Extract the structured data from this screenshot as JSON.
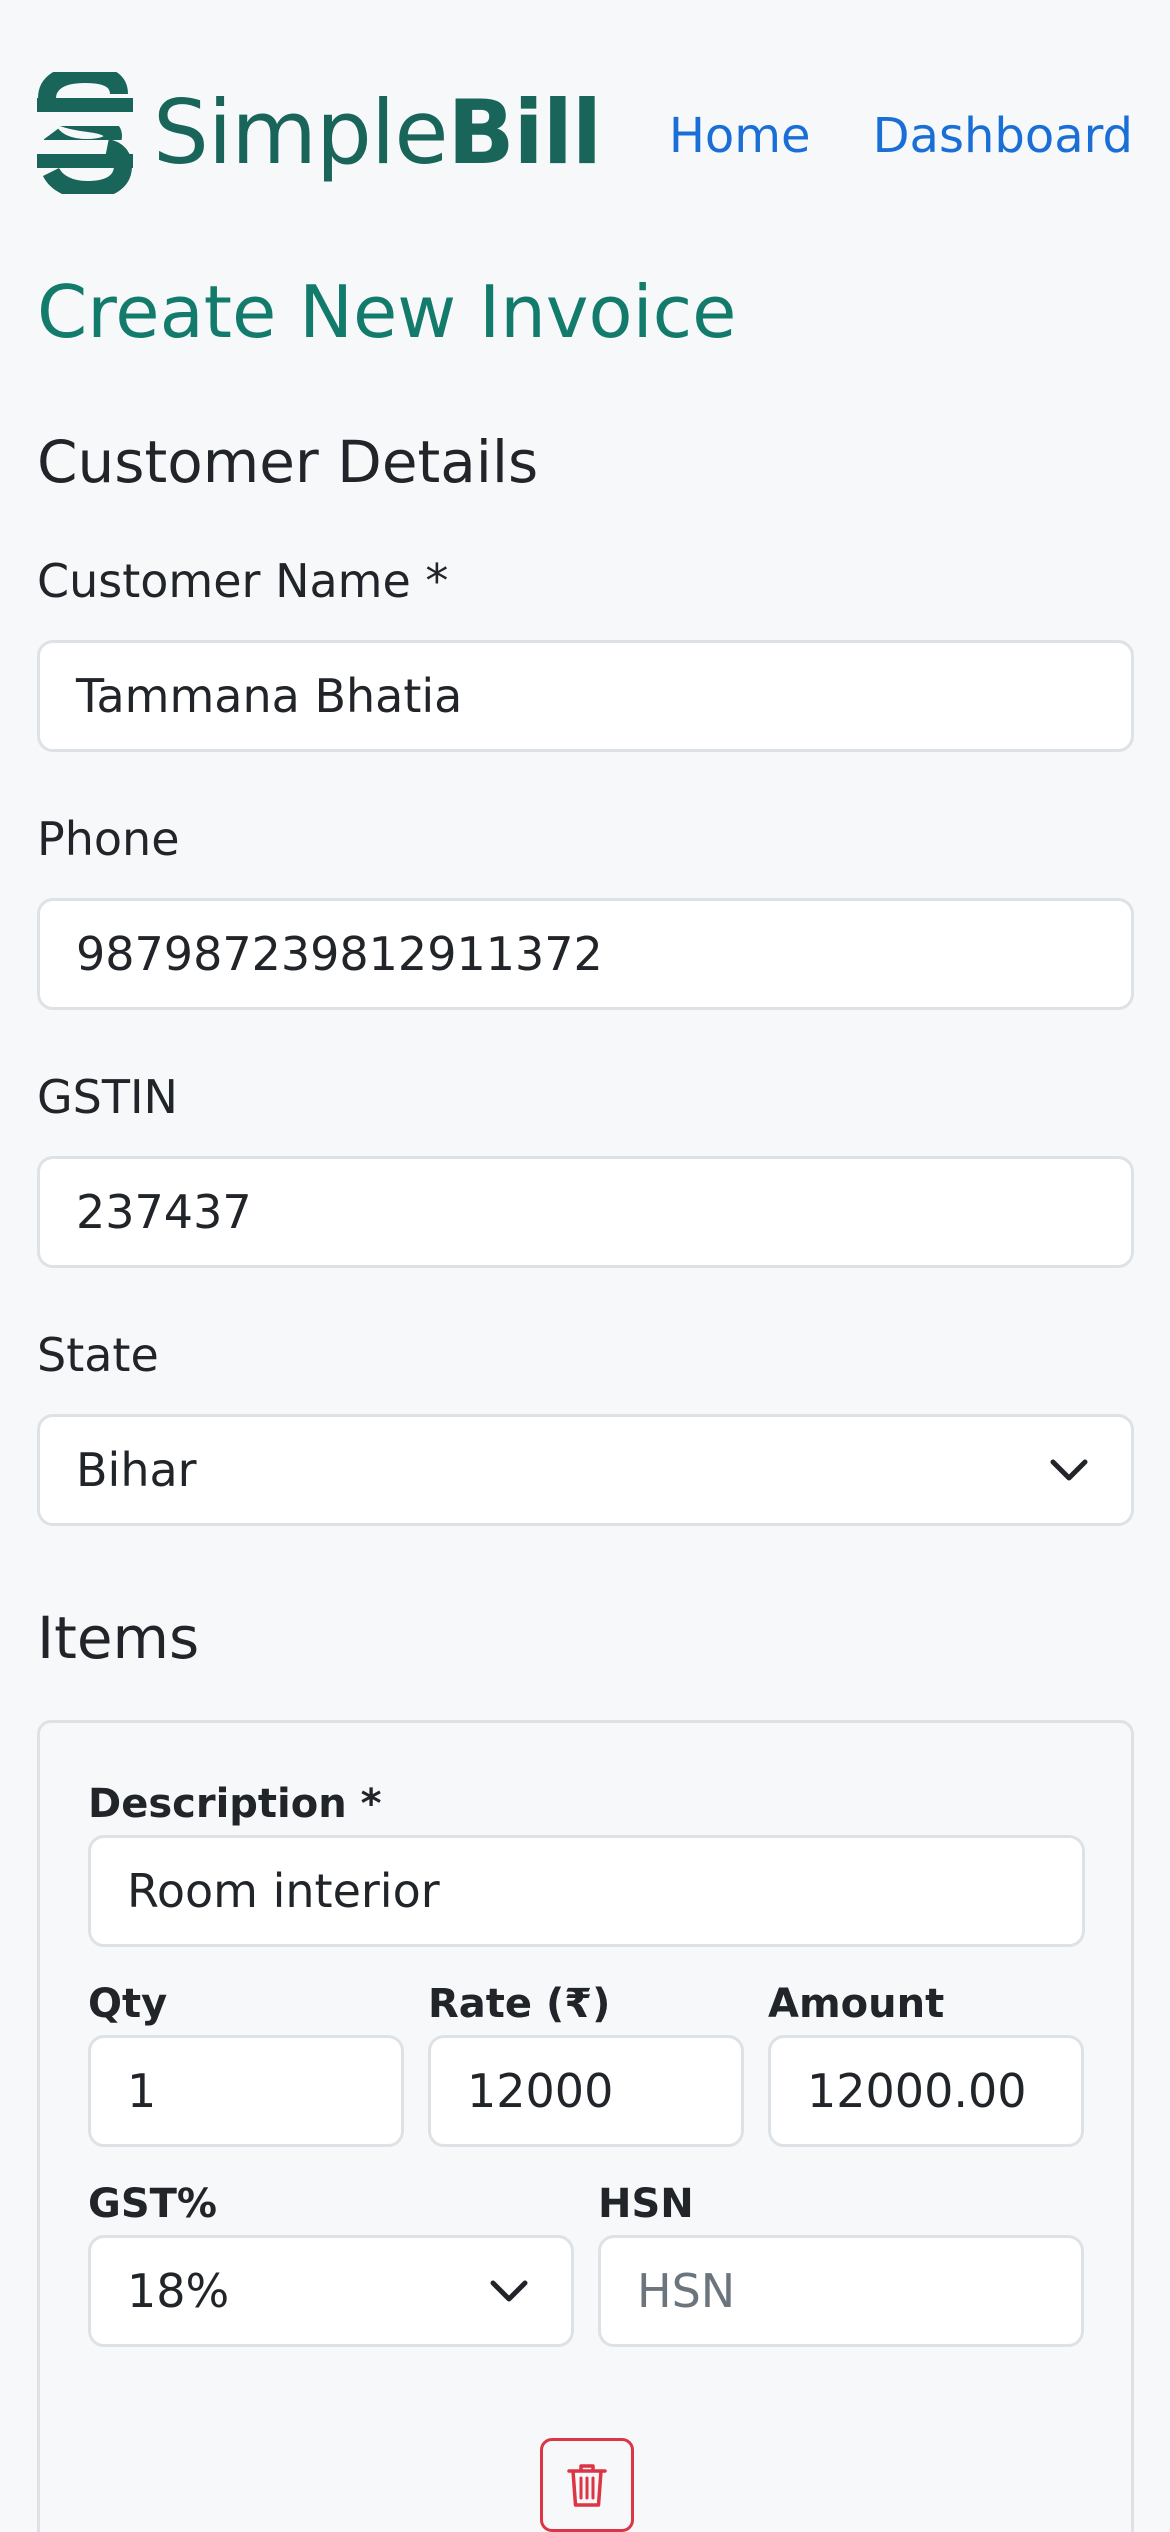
{
  "brand": {
    "name_light": "Simple",
    "name_bold": "Bill",
    "color": "#19655a"
  },
  "nav": {
    "items": [
      "Home",
      "Dashboard"
    ],
    "link_color": "#1a6fd6"
  },
  "page": {
    "title": "Create New Invoice",
    "title_color": "#137b6b"
  },
  "customer": {
    "section_title": "Customer Details",
    "name_label": "Customer Name *",
    "name_value": "Tammana Bhatia",
    "phone_label": "Phone",
    "phone_value": "987987239812911372",
    "gstin_label": "GSTIN",
    "gstin_value": "237437",
    "state_label": "State",
    "state_value": "Bihar"
  },
  "items": {
    "section_title": "Items",
    "rows": [
      {
        "description_label": "Description *",
        "description_value": "Room interior",
        "qty_label": "Qty",
        "qty_value": "1",
        "rate_label": "Rate (₹)",
        "rate_value": "12000",
        "amount_label": "Amount",
        "amount_value": "12000.00",
        "gst_label": "GST%",
        "gst_value": "18%",
        "hsn_label": "HSN",
        "hsn_placeholder": "HSN",
        "delete_icon": "trash-icon",
        "delete_color": "#dc3545"
      }
    ]
  }
}
